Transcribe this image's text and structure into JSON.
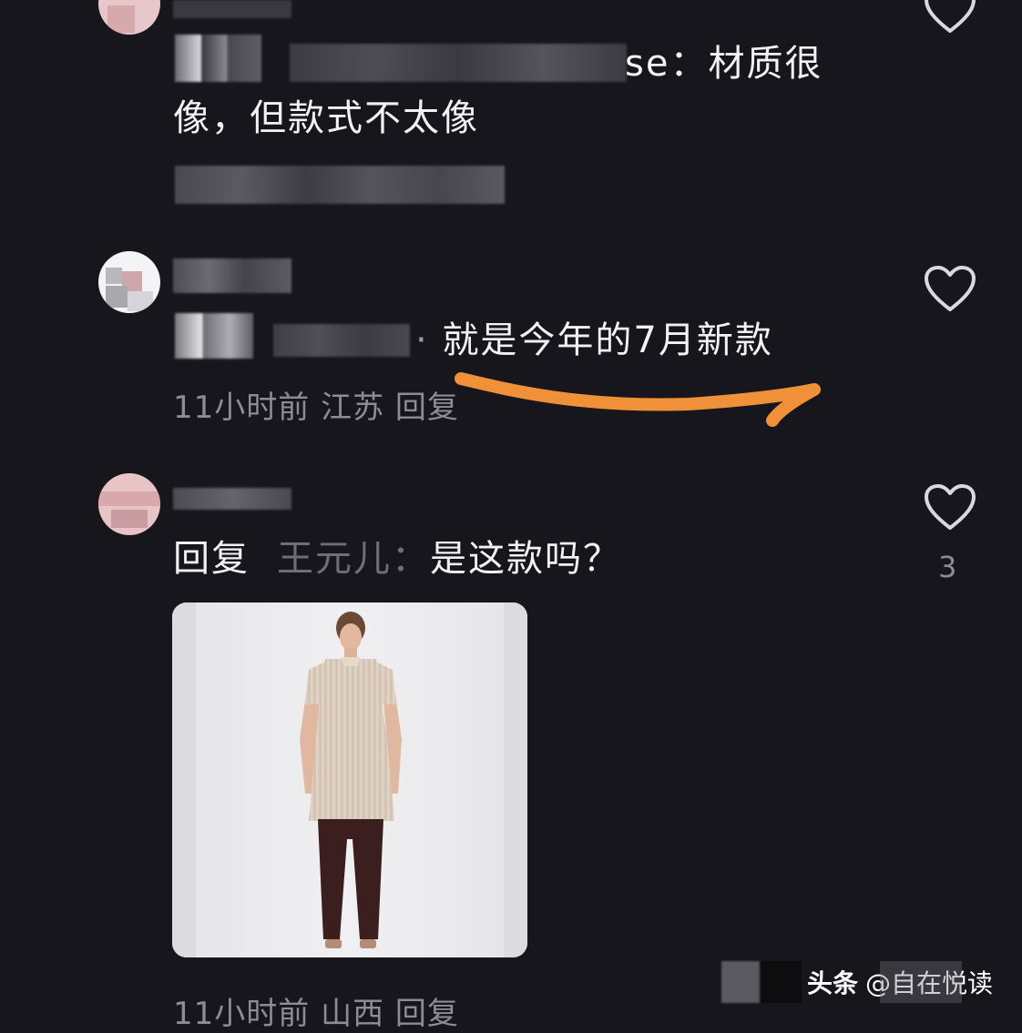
{
  "comments": [
    {
      "username": "",
      "text_line1": "se：材质很",
      "text_line2": "像，但款式不太像",
      "meta": "",
      "likes": ""
    },
    {
      "username": "",
      "text": "就是今年的7月新款",
      "meta": "11小时前 江苏 回复",
      "likes": ""
    },
    {
      "username": "",
      "reply_prefix": "回复",
      "reply_target": "王元儿：",
      "text": "是这款吗？",
      "meta": "11小时前 山西 回复",
      "likes": "3"
    }
  ],
  "watermark": {
    "brand": "头条",
    "account": "@自在悦读"
  },
  "colors": {
    "background": "#17161c",
    "text": "#f2f2f4",
    "meta": "#8d8c93",
    "annotation_stroke": "#f0913a"
  },
  "icons": {
    "like": "heart-outline-icon"
  }
}
